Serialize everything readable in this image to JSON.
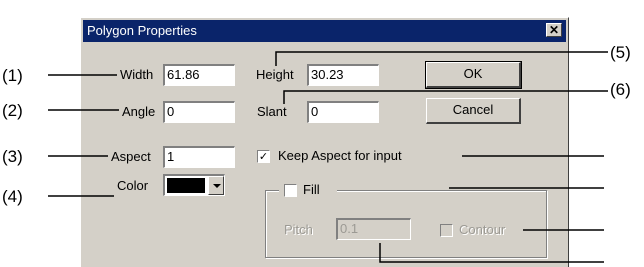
{
  "dialog": {
    "title": "Polygon Properties",
    "close_glyph": "✕"
  },
  "fields": {
    "width": {
      "label": "Width",
      "value": "61.86"
    },
    "height": {
      "label": "Height",
      "value": "30.23"
    },
    "angle": {
      "label": "Angle",
      "value": "0"
    },
    "slant": {
      "label": "Slant",
      "value": "0"
    },
    "aspect": {
      "label": "Aspect",
      "value": "1"
    },
    "color": {
      "label": "Color",
      "swatch": "#000000"
    },
    "pitch": {
      "label": "Pitch",
      "value": "0.1",
      "disabled": true
    }
  },
  "checkboxes": {
    "keep_aspect": {
      "label": "Keep Aspect for input",
      "checked": true,
      "glyph": "✓"
    },
    "fill": {
      "label": "Fill",
      "checked": false
    },
    "contour": {
      "label": "Contour",
      "checked": false,
      "disabled": true
    }
  },
  "buttons": {
    "ok": "OK",
    "cancel": "Cancel"
  },
  "callouts": [
    "(1)",
    "(2)",
    "(3)",
    "(4)",
    "(5)",
    "(6)"
  ],
  "colors": {
    "titlebar": "#0a246a",
    "dialog_face": "#d4d0c8",
    "disabled_text": "#9c9a94"
  }
}
